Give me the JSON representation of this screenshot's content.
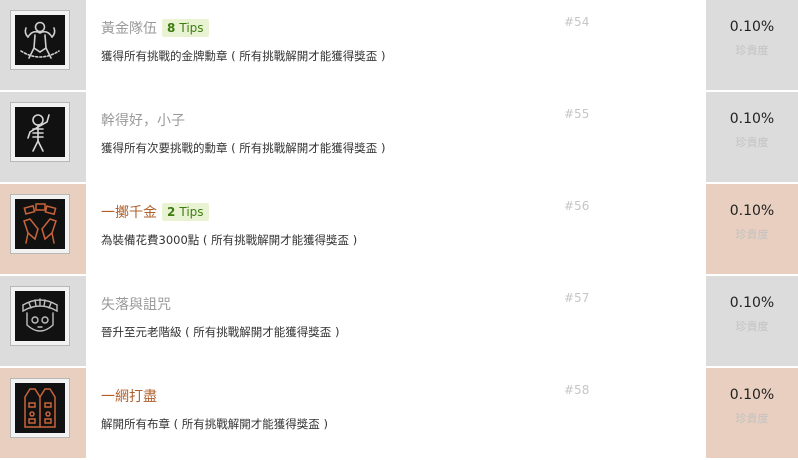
{
  "rarity_label": "珍貴度",
  "achievements": [
    {
      "title": "黃金隊伍",
      "tips": {
        "count": "8",
        "label": "Tips"
      },
      "desc": "獲得所有挑戰的金牌勳章 ( 所有挑戰解開才能獲得獎盃 )",
      "rank": "#54",
      "percent": "0.10%",
      "icon": "muscle-man-icon",
      "tone": "gray"
    },
    {
      "title": "幹得好，小子",
      "desc": "獲得所有次要挑戰的勳章 ( 所有挑戰解開才能獲得獎盃 )",
      "rank": "#55",
      "percent": "0.10%",
      "icon": "skeleton-flex-icon",
      "tone": "gray"
    },
    {
      "title": "一擲千金",
      "tips": {
        "count": "2",
        "label": "Tips"
      },
      "desc": "為裝備花費3000點 ( 所有挑戰解開才能獲得獎盃 )",
      "rank": "#56",
      "percent": "0.10%",
      "icon": "money-hands-icon",
      "tone": "warm"
    },
    {
      "title": "失落與詛咒",
      "desc": "晉升至元老階級 ( 所有挑戰解開才能獲得獎盃 )",
      "rank": "#57",
      "percent": "0.10%",
      "icon": "founder-badge-icon",
      "tone": "gray"
    },
    {
      "title": "一網打盡",
      "desc": "解開所有布章 ( 所有挑戰解開才能獲得獎盃 )",
      "rank": "#58",
      "percent": "0.10%",
      "icon": "patch-vest-icon",
      "tone": "warm"
    }
  ]
}
